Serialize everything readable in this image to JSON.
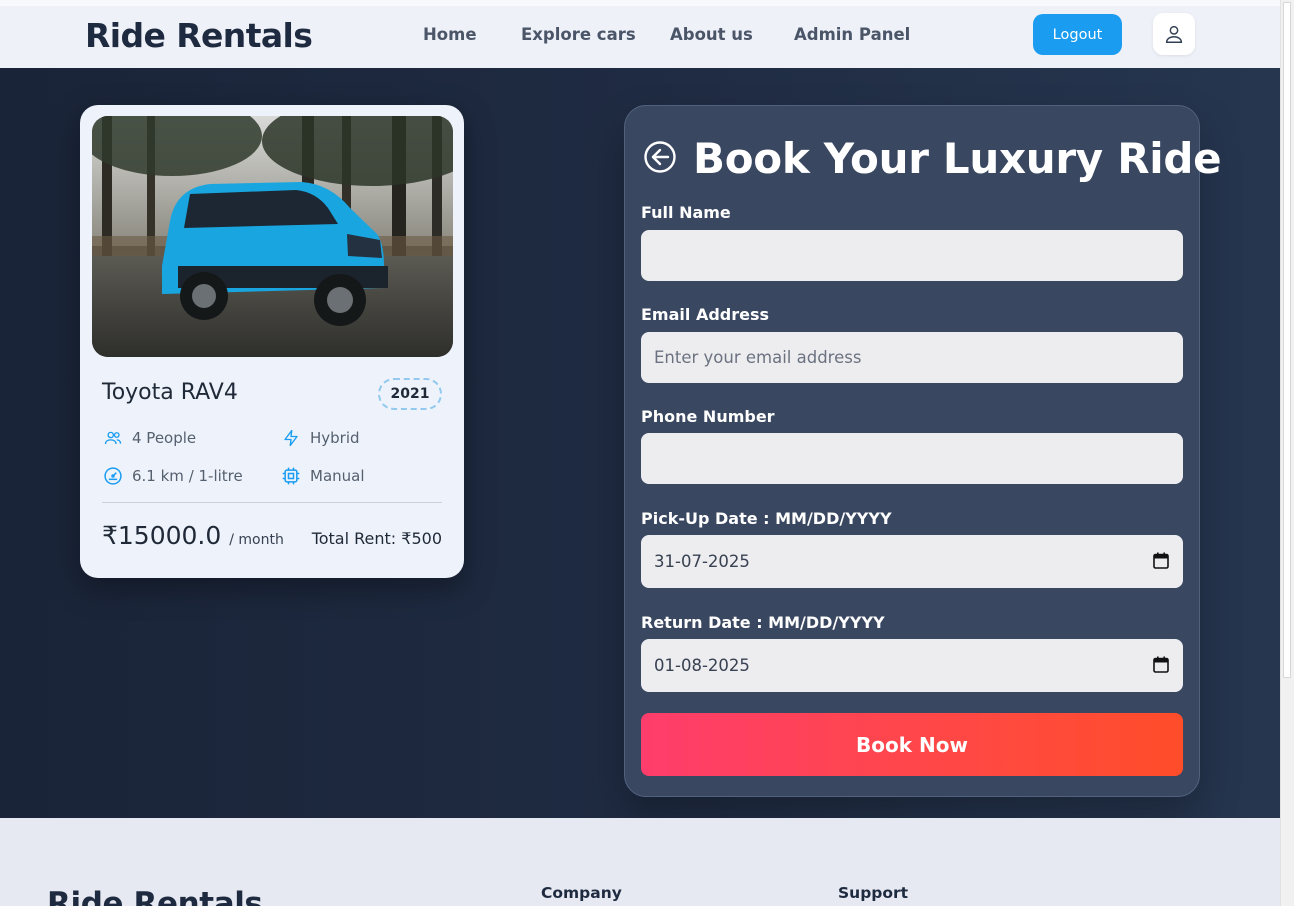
{
  "navbar": {
    "brand": "Ride Rentals",
    "links": [
      "Home",
      "Explore cars",
      "About us",
      "Admin Panel"
    ],
    "logout_label": "Logout",
    "user_icon": "user-icon"
  },
  "car": {
    "name": "Toyota RAV4",
    "year": "2021",
    "specs": [
      {
        "icon": "people-icon",
        "label": "4 People"
      },
      {
        "icon": "lightning-icon",
        "label": "Hybrid"
      },
      {
        "icon": "speedometer-icon",
        "label": "6.1 km / 1-litre"
      },
      {
        "icon": "chip-icon",
        "label": "Manual"
      }
    ],
    "price": "₹15000.0",
    "price_unit": "/ month",
    "total_rent": "Total Rent: ₹500",
    "accent_color": "#1a9cf0"
  },
  "booking": {
    "title": "Book Your Luxury Ride",
    "fields": {
      "full_name": {
        "label": "Full Name",
        "value": "",
        "placeholder": ""
      },
      "email": {
        "label": "Email Address",
        "value": "",
        "placeholder": "Enter your email address"
      },
      "phone": {
        "label": "Phone Number",
        "value": "",
        "placeholder": ""
      },
      "pickup": {
        "label": "Pick-Up Date : MM/DD/YYYY",
        "value": "31-07-2025"
      },
      "return": {
        "label": "Return Date : MM/DD/YYYY",
        "value": "01-08-2025"
      }
    },
    "submit_label": "Book Now"
  },
  "footer": {
    "brand": "Ride Rentals",
    "columns": [
      "Company",
      "Support"
    ]
  }
}
